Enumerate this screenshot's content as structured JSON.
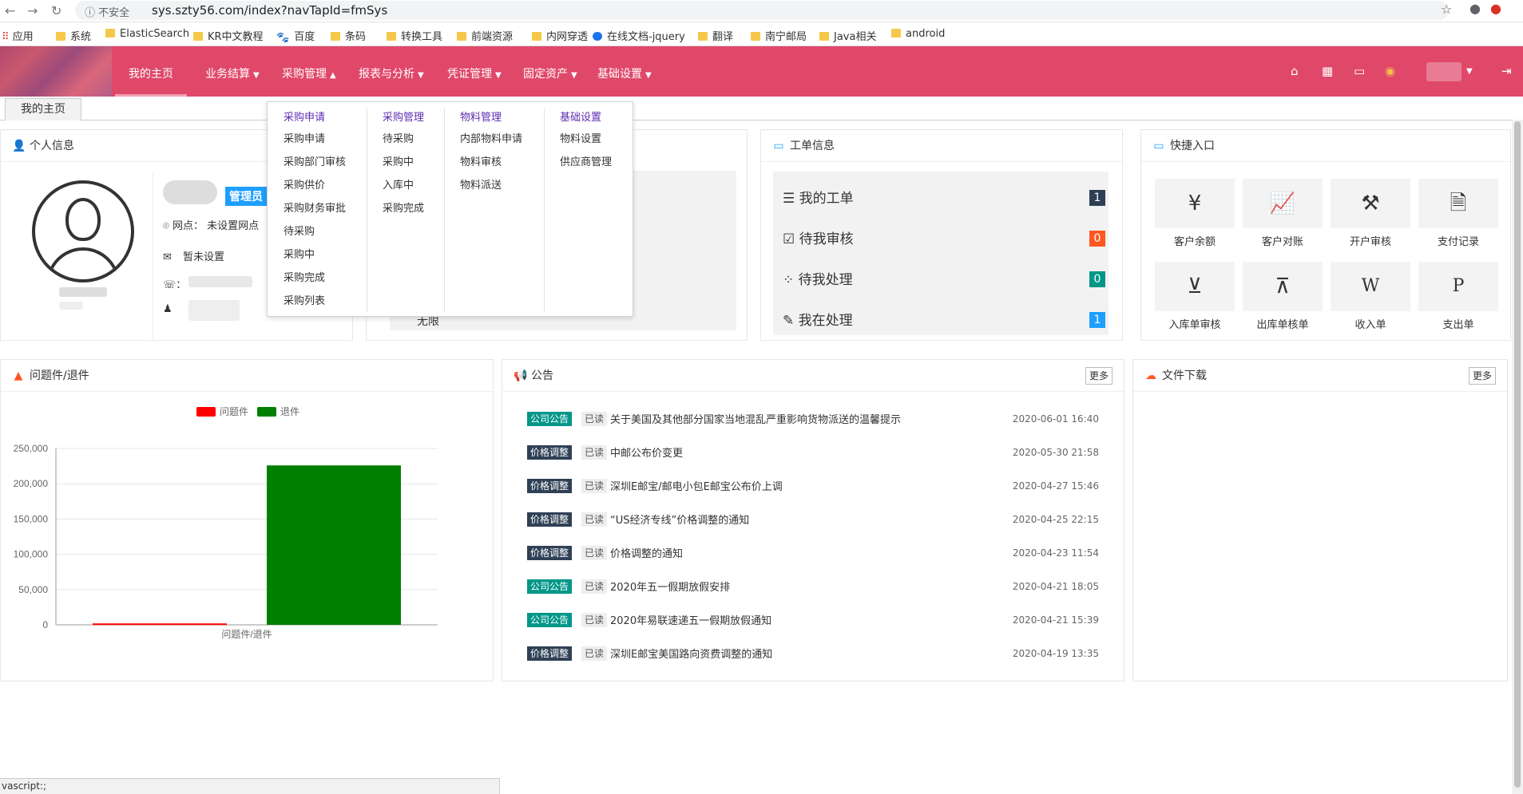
{
  "browser": {
    "security": "不安全",
    "url": "sys.szty56.com/index?navTapId=fmSys",
    "bookmarks": [
      "应用",
      "系统",
      "ElasticSearch",
      "KR中文教程",
      "百度",
      "条码",
      "转换工具",
      "前端资源",
      "内网穿透",
      "在线文档-jquery",
      "翻译",
      "南宁邮局",
      "Java相关",
      "android"
    ]
  },
  "nav": {
    "items": [
      {
        "label": "我的主页",
        "caret": false
      },
      {
        "label": "业务结算",
        "caret": true
      },
      {
        "label": "采购管理",
        "caret": true
      },
      {
        "label": "报表与分析",
        "caret": true
      },
      {
        "label": "凭证管理",
        "caret": true
      },
      {
        "label": "固定资产",
        "caret": true
      },
      {
        "label": "基础设置",
        "caret": true
      }
    ],
    "icons": [
      "home-icon",
      "grid-icon",
      "monitor-icon",
      "user-avatar-icon",
      "logout-icon"
    ]
  },
  "tabs": [
    "我的主页"
  ],
  "dropdown": {
    "columns": [
      {
        "title": "采购申请",
        "items": [
          "采购申请",
          "采购部门审核",
          "采购供价",
          "采购财务审批",
          "待采购",
          "采购中",
          "采购完成",
          "采购列表"
        ]
      },
      {
        "title": "采购管理",
        "items": [
          "待采购",
          "采购中",
          "入库中",
          "采购完成"
        ]
      },
      {
        "title": "物料管理",
        "items": [
          "内部物料申请",
          "物料审核",
          "物料派送"
        ]
      },
      {
        "title": "基础设置",
        "items": [
          "物料设置",
          "供应商管理"
        ]
      }
    ]
  },
  "personal": {
    "title": "个人信息",
    "role": "管理员",
    "branch_label": "网点：",
    "branch_value": "未设置网点",
    "email_value": "暂未设置",
    "phone_label": "：",
    "partial_text": "无限"
  },
  "workorders": {
    "title": "工单信息",
    "rows": [
      {
        "label": "我的工单",
        "count": "1",
        "color": "#2f4056",
        "icon": "list-icon"
      },
      {
        "label": "待我审核",
        "count": "0",
        "color": "#ff5722",
        "icon": "check-square-icon"
      },
      {
        "label": "待我处理",
        "count": "0",
        "color": "#009688",
        "icon": "spinner-icon"
      },
      {
        "label": "我在处理",
        "count": "1",
        "color": "#1e9fff",
        "icon": "edit-icon"
      }
    ]
  },
  "shortcuts": {
    "title": "快捷入口",
    "items": [
      {
        "label": "客户余额",
        "icon": "yen-icon",
        "glyph": "¥"
      },
      {
        "label": "客户对账",
        "icon": "trend-chart-icon",
        "glyph": "📈"
      },
      {
        "label": "开户审核",
        "icon": "gavel-icon",
        "glyph": "⚒"
      },
      {
        "label": "支付记录",
        "icon": "document-icon",
        "glyph": "🗎"
      },
      {
        "label": "入库单审核",
        "icon": "caret-down-box-icon",
        "glyph": "⊻"
      },
      {
        "label": "出库单核单",
        "icon": "caret-up-box-icon",
        "glyph": "⊼"
      },
      {
        "label": "收入单",
        "icon": "word-file-icon",
        "glyph": "W"
      },
      {
        "label": "支出单",
        "icon": "p-file-icon",
        "glyph": "P"
      }
    ]
  },
  "problems": {
    "title": "问题件/退件",
    "chart_data": {
      "type": "bar",
      "categories": [
        "问题件/退件"
      ],
      "series": [
        {
          "name": "问题件",
          "values": [
            2000
          ],
          "color": "#ff0000"
        },
        {
          "name": "退件",
          "values": [
            226000
          ],
          "color": "#008000"
        }
      ],
      "yticks": [
        "0",
        "50,000",
        "100,000",
        "150,000",
        "200,000",
        "250,000"
      ],
      "ylim": [
        0,
        250000
      ],
      "legend": "top-center",
      "xlabel": "问题件/退件"
    }
  },
  "notices": {
    "title": "公告",
    "more": "更多",
    "items": [
      {
        "tag": "公司公告",
        "tag_color": "#009688",
        "read": "已读",
        "title": "关于美国及其他部分国家当地混乱严重影响货物派送的温馨提示",
        "date": "2020-06-01 16:40"
      },
      {
        "tag": "价格调整",
        "tag_color": "#2f4056",
        "read": "已读",
        "title": "中邮公布价变更",
        "date": "2020-05-30 21:58"
      },
      {
        "tag": "价格调整",
        "tag_color": "#2f4056",
        "read": "已读",
        "title": "深圳E邮宝/邮电小包E邮宝公布价上调",
        "date": "2020-04-27 15:46"
      },
      {
        "tag": "价格调整",
        "tag_color": "#2f4056",
        "read": "已读",
        "title": "“US经济专线”价格调整的通知",
        "date": "2020-04-25 22:15"
      },
      {
        "tag": "价格调整",
        "tag_color": "#2f4056",
        "read": "已读",
        "title": "价格调整的通知",
        "date": "2020-04-23 11:54"
      },
      {
        "tag": "公司公告",
        "tag_color": "#009688",
        "read": "已读",
        "title": "2020年五一假期放假安排",
        "date": "2020-04-21 18:05"
      },
      {
        "tag": "公司公告",
        "tag_color": "#009688",
        "read": "已读",
        "title": "2020年易联速递五一假期放假通知",
        "date": "2020-04-21 15:39"
      },
      {
        "tag": "价格调整",
        "tag_color": "#2f4056",
        "read": "已读",
        "title": "深圳E邮宝美国路向资费调整的通知",
        "date": "2020-04-19 13:35"
      }
    ]
  },
  "downloads": {
    "title": "文件下载",
    "more": "更多"
  },
  "status": "vascript:;"
}
